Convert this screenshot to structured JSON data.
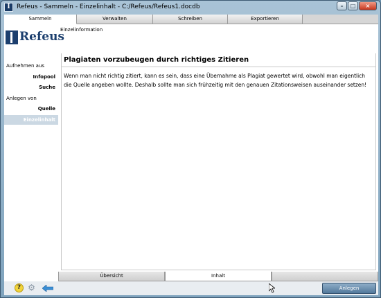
{
  "window": {
    "title": "Refeus - Sammeln - Einzelinhalt - C:/Refeus/Refeus1.docdb",
    "app_icon_letter": "I"
  },
  "tabs": [
    {
      "label": "Sammeln",
      "active": true
    },
    {
      "label": "Verwalten",
      "active": false
    },
    {
      "label": "Schreiben",
      "active": false
    },
    {
      "label": "Exportieren",
      "active": false
    }
  ],
  "logo": {
    "text": "Refeus"
  },
  "sidebar": {
    "group1_heading": "Aufnehmen aus",
    "items1": [
      "Infopool",
      "Suche"
    ],
    "group2_heading": "Anlegen von",
    "items2": [
      "Quelle",
      "Einzelinhalt"
    ],
    "active": "Einzelinhalt"
  },
  "breadcrumb": "Einzelinformation",
  "content": {
    "heading": "Plagiaten vorzubeugen durch richtiges Zitieren",
    "body": "Wenn man nicht richtig zitiert, kann es sein, dass eine Übernahme als Plagiat gewertet wird, obwohl man eigentlich die Quelle angeben wollte. Deshalb sollte man sich frühzeitig mit den genauen Zitationsweisen auseinander setzen!"
  },
  "bottom_tabs": [
    {
      "label": "Übersicht",
      "active": false
    },
    {
      "label": "Inhalt",
      "active": true
    },
    {
      "label": "",
      "active": false
    }
  ],
  "footer": {
    "help_symbol": "?",
    "add_button": "Anlegen"
  },
  "icons": {
    "help": "help-icon",
    "settings": "gear-icon",
    "back": "back-arrow-icon",
    "cursor": "mouse-cursor-icon"
  },
  "colors": {
    "brand": "#1c3f6e",
    "active_nav": "#cbd8e3",
    "primary_button": "#52789b"
  }
}
